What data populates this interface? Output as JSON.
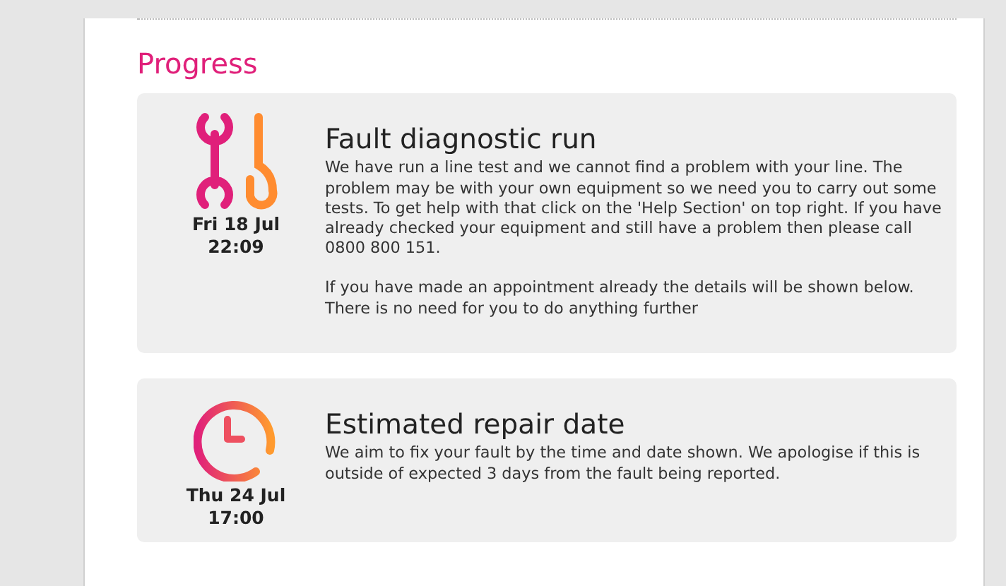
{
  "section_title": "Progress",
  "events": [
    {
      "kind": "tools",
      "date": "Fri 18 Jul",
      "time": "22:09",
      "title": "Fault diagnostic run",
      "paragraphs": [
        "We have run a line test and we cannot find a problem with your line. The problem may be with your own equipment so we need you to carry out some tests. To get help with that click on the 'Help Section' on top right. If you have already checked your equipment and still have a problem then please call 0800 800 151.",
        "If you have made an appointment already the details will be shown below. There is no need for you to do anything further"
      ]
    },
    {
      "kind": "clock",
      "date": "Thu 24 Jul",
      "time": "17:00",
      "title": "Estimated repair date",
      "paragraphs": [
        "We aim to fix your fault by the time and date shown. We apologise if this is outside of expected 3 days from the fault being reported."
      ]
    }
  ]
}
